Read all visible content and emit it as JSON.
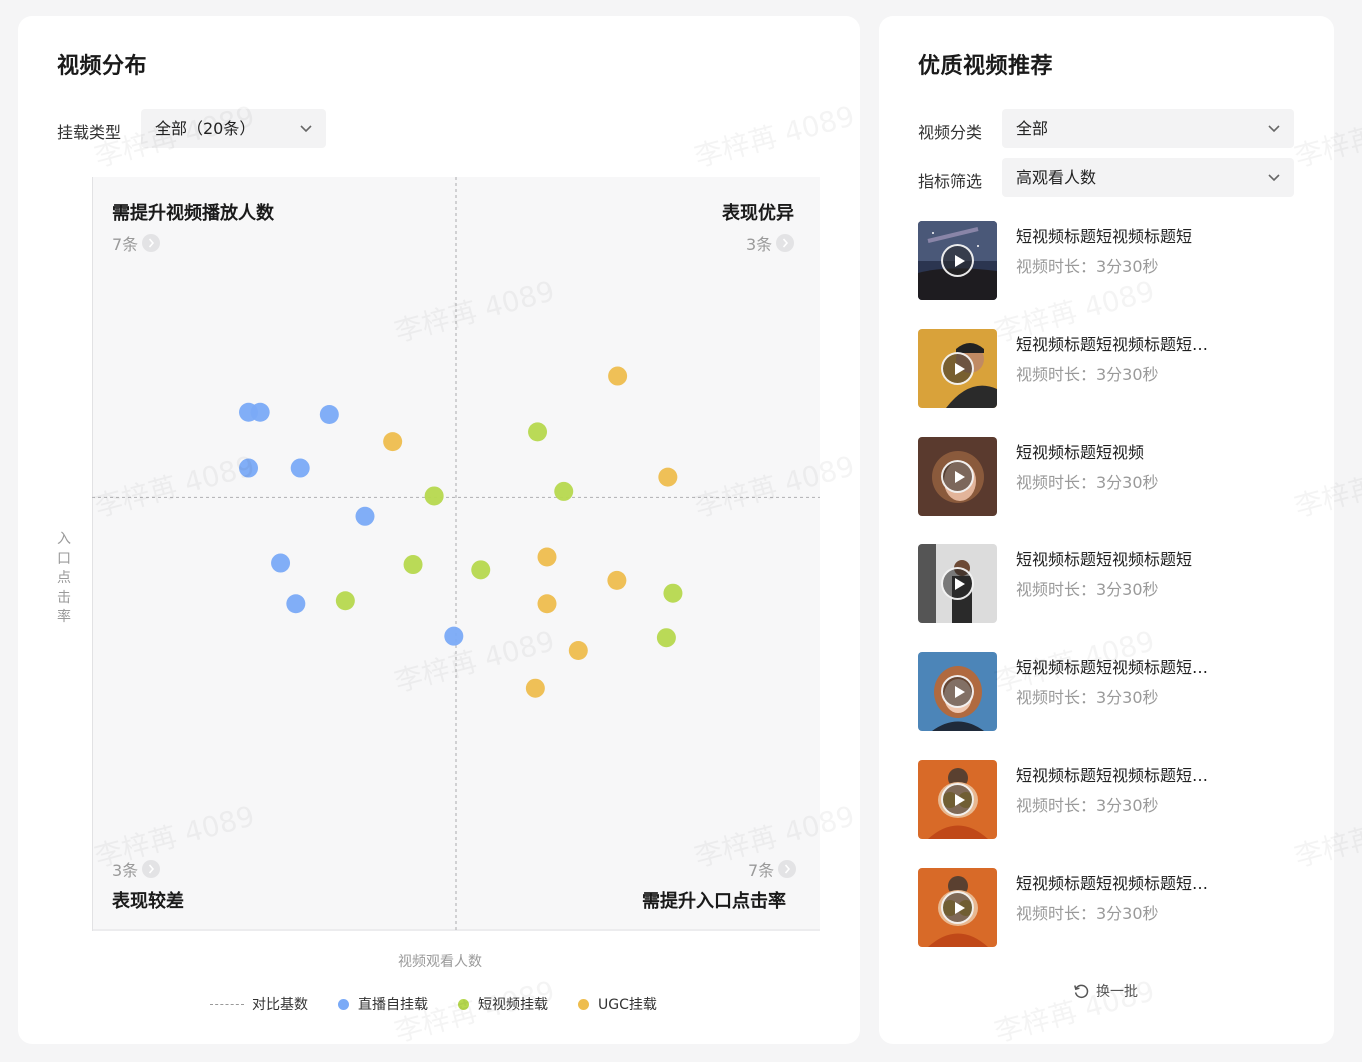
{
  "distribution": {
    "title": "视频分布",
    "mount_type_label": "挂载类型",
    "mount_type_value": "全部（20条）",
    "quadrants": {
      "top_left": {
        "title": "需提升视频播放人数",
        "count": "7条"
      },
      "top_right": {
        "title": "表现优异",
        "count": "3条"
      },
      "bottom_left": {
        "title": "表现较差",
        "count": "3条"
      },
      "bottom_right": {
        "title": "需提升入口点击率",
        "count": "7条"
      }
    },
    "legend": {
      "baseline": "对比基数",
      "live": "直播自挂载",
      "short": "短视频挂载",
      "ugc": "UGC挂载"
    }
  },
  "chart_data": {
    "type": "scatter",
    "xlabel": "视频观看人数",
    "ylabel": "入口点击率",
    "xlim": [
      0,
      100
    ],
    "ylim": [
      0,
      100
    ],
    "baseline": {
      "x": 50,
      "y": 57.5
    },
    "grid": false,
    "legend_position": "bottom",
    "colors": {
      "live": "#7aaaf7",
      "short": "#b6d84e",
      "ugc": "#eebd4e"
    },
    "series": [
      {
        "key": "live",
        "name": "直播自挂载",
        "points": [
          {
            "x": 21.5,
            "y": 68.8
          },
          {
            "x": 23.1,
            "y": 68.8
          },
          {
            "x": 32.6,
            "y": 68.5
          },
          {
            "x": 21.5,
            "y": 61.4
          },
          {
            "x": 28.6,
            "y": 61.4
          },
          {
            "x": 37.5,
            "y": 55.0
          },
          {
            "x": 25.9,
            "y": 48.8
          },
          {
            "x": 28.0,
            "y": 43.4
          },
          {
            "x": 49.7,
            "y": 39.1
          }
        ]
      },
      {
        "key": "short",
        "name": "短视频挂载",
        "points": [
          {
            "x": 61.2,
            "y": 66.2
          },
          {
            "x": 47.0,
            "y": 57.7
          },
          {
            "x": 64.8,
            "y": 58.3
          },
          {
            "x": 44.1,
            "y": 48.6
          },
          {
            "x": 53.4,
            "y": 47.9
          },
          {
            "x": 34.8,
            "y": 43.8
          },
          {
            "x": 79.8,
            "y": 44.8
          },
          {
            "x": 78.9,
            "y": 38.9
          }
        ]
      },
      {
        "key": "ugc",
        "name": "UGC挂载",
        "points": [
          {
            "x": 72.2,
            "y": 73.6
          },
          {
            "x": 41.3,
            "y": 64.9
          },
          {
            "x": 79.1,
            "y": 60.2
          },
          {
            "x": 62.5,
            "y": 49.6
          },
          {
            "x": 72.1,
            "y": 46.5
          },
          {
            "x": 62.5,
            "y": 43.4
          },
          {
            "x": 66.8,
            "y": 37.2
          },
          {
            "x": 60.9,
            "y": 32.2
          }
        ]
      }
    ]
  },
  "recommend": {
    "title": "优质视频推荐",
    "category_label": "视频分类",
    "category_value": "全部",
    "metric_label": "指标筛选",
    "metric_value": "高观看人数",
    "refresh_label": "换一批",
    "videos": [
      {
        "title": "短视频标题短视频标题短",
        "duration": "视频时长：3分30秒",
        "thumb": "night-sky"
      },
      {
        "title": "短视频标题短视频标题短视频标题",
        "duration": "视频时长：3分30秒",
        "thumb": "man-yellow"
      },
      {
        "title": "短视频标题短视频",
        "duration": "视频时长：3分30秒",
        "thumb": "woman-curly"
      },
      {
        "title": "短视频标题短视频标题短",
        "duration": "视频时长：3分30秒",
        "thumb": "man-standing"
      },
      {
        "title": "短视频标题短视频标题短视频标题",
        "duration": "视频时长：3分30秒",
        "thumb": "woman-blue"
      },
      {
        "title": "短视频标题短视频标题短视频标题",
        "duration": "视频时长：3分30秒",
        "thumb": "girl-orange"
      },
      {
        "title": "短视频标题短视频标题短视频标题",
        "duration": "视频时长：3分30秒",
        "thumb": "girl-orange"
      }
    ]
  },
  "watermark": "李梓苒 4089"
}
